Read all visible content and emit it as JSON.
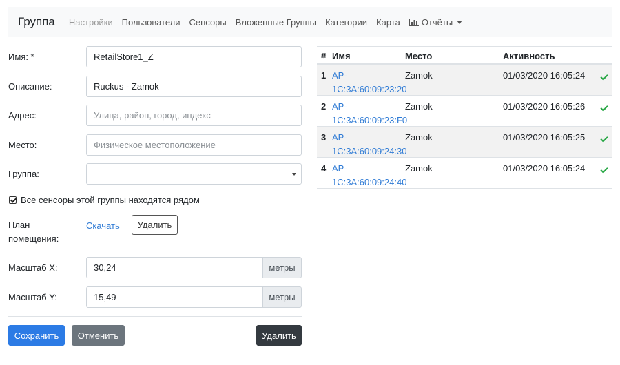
{
  "nav": {
    "brand": "Группа",
    "items": [
      {
        "label": "Настройки"
      },
      {
        "label": "Пользователи"
      },
      {
        "label": "Сенсоры"
      },
      {
        "label": "Вложенные Группы"
      },
      {
        "label": "Категории"
      },
      {
        "label": "Карта"
      },
      {
        "label": "Отчёты"
      }
    ]
  },
  "form": {
    "name_label": "Имя: *",
    "name_value": "RetailStore1_Z",
    "description_label": "Описание:",
    "description_value": "Ruckus - Zamok",
    "address_label": "Адрес:",
    "address_placeholder": "Улица, район, город, индекс",
    "place_label": "Место:",
    "place_placeholder": "Физическое местоположение",
    "group_label": "Группа:",
    "group_value": "",
    "checkbox_label": "Все сенсоры этой группы находятся рядом",
    "checkbox_checked": true,
    "plan_label": "План помещения:",
    "download_label": "Скачать",
    "delete_plan_label": "Удалить",
    "scale_x_label": "Масштаб X:",
    "scale_x_value": "30,24",
    "scale_y_label": "Масштаб Y:",
    "scale_y_value": "15,49",
    "unit_label": "метры"
  },
  "buttons": {
    "save": "Сохранить",
    "cancel": "Отменить",
    "delete": "Удалить"
  },
  "table": {
    "headers": [
      "#",
      "Имя",
      "Место",
      "Активность"
    ],
    "rows": [
      {
        "num": "1",
        "name": "AP-1C:3A:60:09:23:20",
        "place": "Zamok",
        "activity": "01/03/2020 16:05:24",
        "status": "ok"
      },
      {
        "num": "2",
        "name": "AP-1C:3A:60:09:23:F0",
        "place": "Zamok",
        "activity": "01/03/2020 16:05:26",
        "status": "ok"
      },
      {
        "num": "3",
        "name": "AP-1C:3A:60:09:24:30",
        "place": "Zamok",
        "activity": "01/03/2020 16:05:25",
        "status": "ok"
      },
      {
        "num": "4",
        "name": "AP-1C:3A:60:09:24:40",
        "place": "Zamok",
        "activity": "01/03/2020 16:05:24",
        "status": "ok"
      }
    ]
  },
  "colors": {
    "primary": "#2c7be5",
    "secondary": "#6c757d",
    "dark": "#343a40",
    "success": "#28a745",
    "link": "#2f7bd5"
  }
}
